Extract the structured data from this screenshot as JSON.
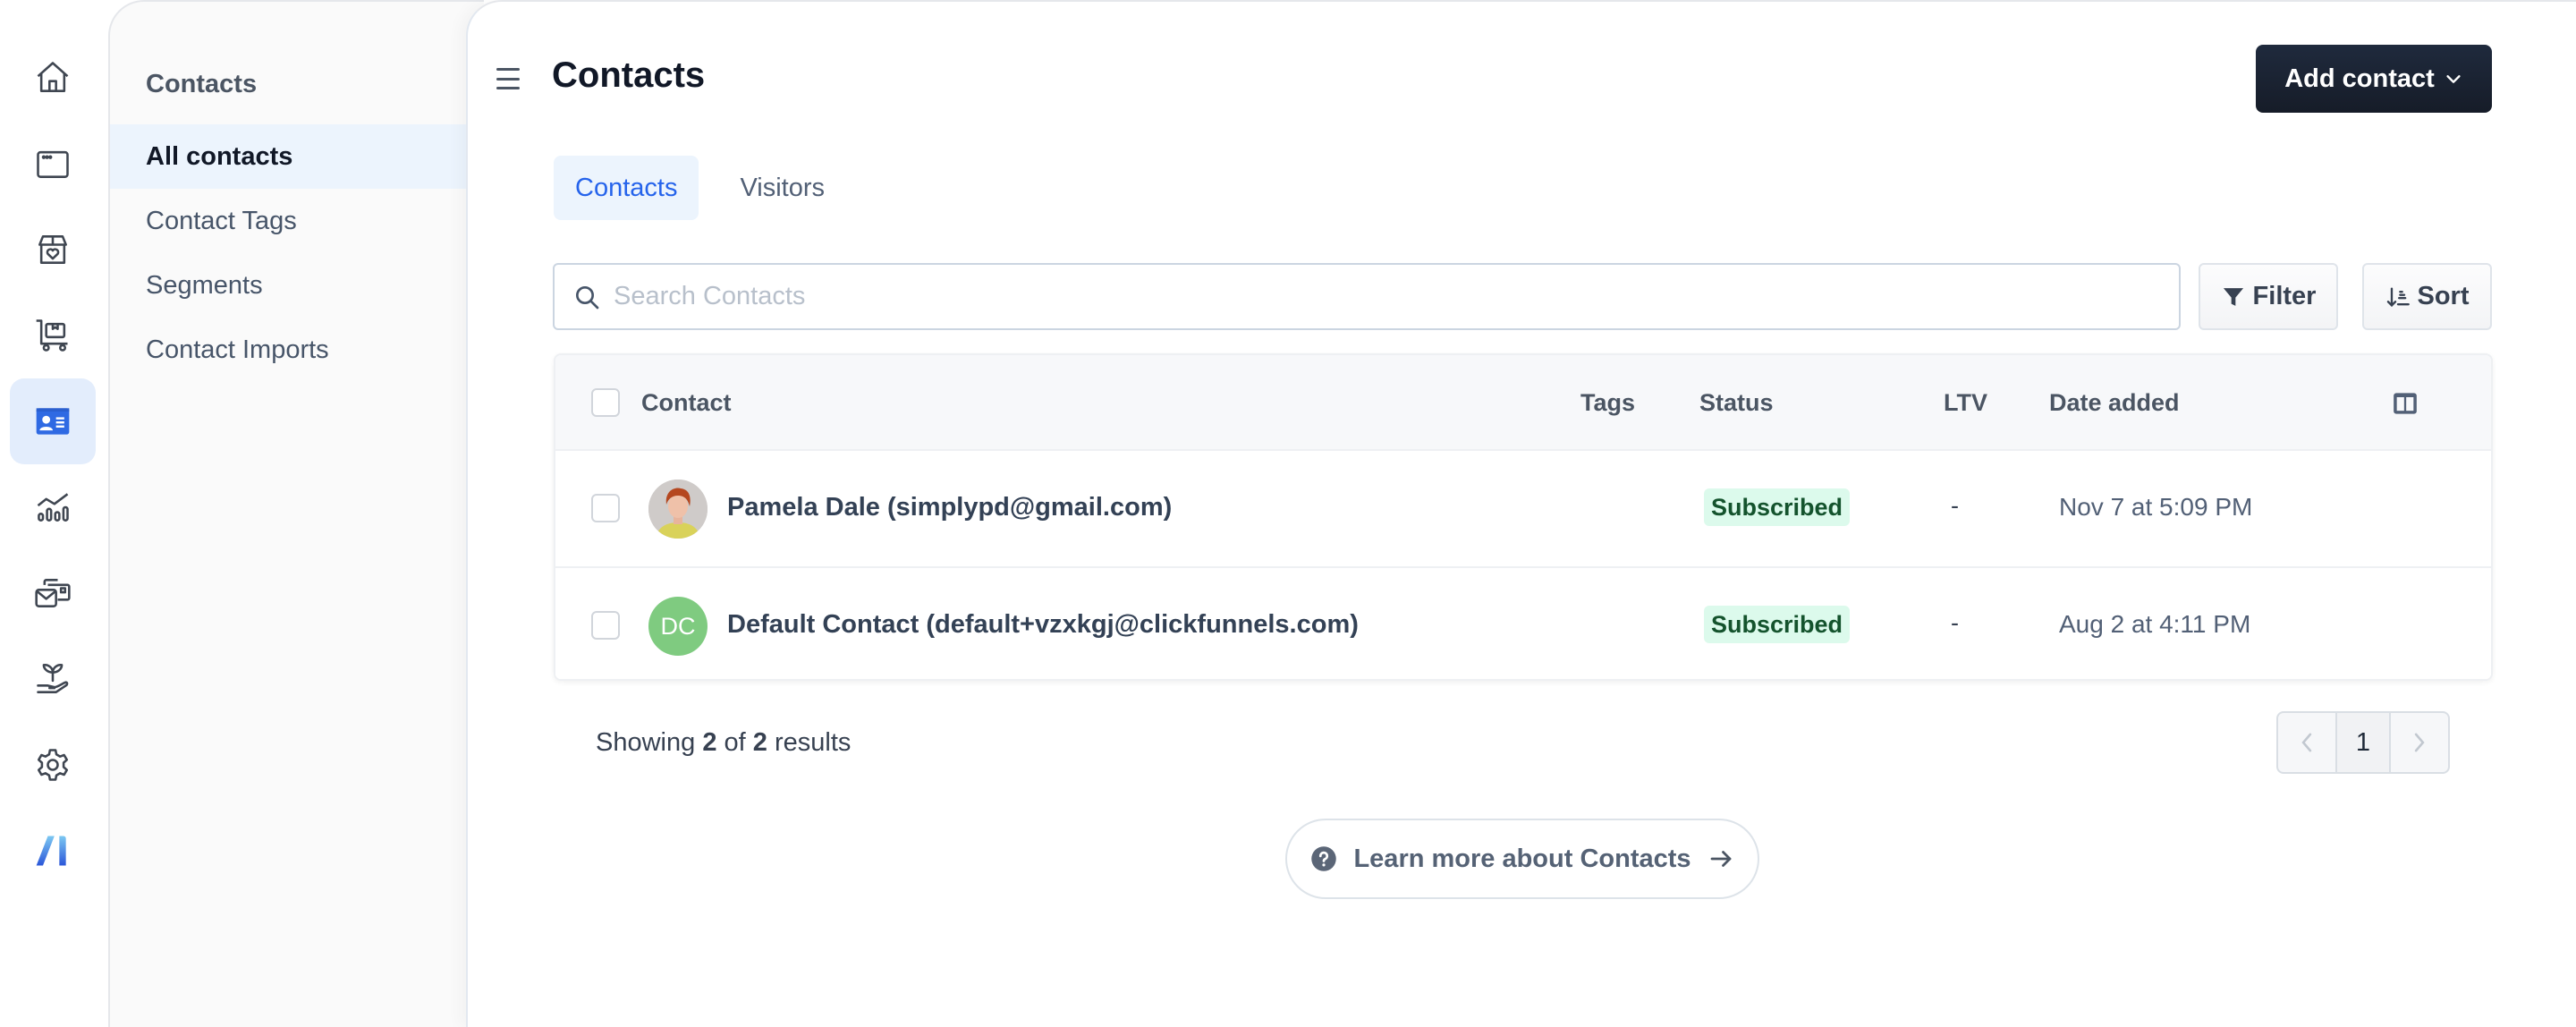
{
  "rail": {
    "items": [
      {
        "name": "home",
        "icon": "home-icon",
        "active": false
      },
      {
        "name": "sites",
        "icon": "browser-window-icon",
        "active": false
      },
      {
        "name": "products",
        "icon": "box-heart-icon",
        "active": false
      },
      {
        "name": "orders",
        "icon": "cart-box-icon",
        "active": false
      },
      {
        "name": "contacts",
        "icon": "contact-card-icon",
        "active": true
      },
      {
        "name": "analytics",
        "icon": "chart-icon",
        "active": false
      },
      {
        "name": "marketing",
        "icon": "mail-wallet-icon",
        "active": false
      },
      {
        "name": "grow",
        "icon": "plant-hand-icon",
        "active": false
      },
      {
        "name": "settings",
        "icon": "gear-icon",
        "active": false
      },
      {
        "name": "ai",
        "icon": "ai-logo-icon",
        "active": false
      }
    ]
  },
  "subnav": {
    "title": "Contacts",
    "items": [
      {
        "label": "All contacts",
        "active": true
      },
      {
        "label": "Contact Tags",
        "active": false
      },
      {
        "label": "Segments",
        "active": false
      },
      {
        "label": "Contact Imports",
        "active": false
      }
    ]
  },
  "header": {
    "title": "Contacts",
    "add_button_label": "Add contact"
  },
  "tabs": [
    {
      "label": "Contacts",
      "active": true
    },
    {
      "label": "Visitors",
      "active": false
    }
  ],
  "search": {
    "placeholder": "Search Contacts",
    "value": ""
  },
  "toolbar": {
    "filter_label": "Filter",
    "sort_label": "Sort"
  },
  "table": {
    "columns": [
      "Contact",
      "Tags",
      "Status",
      "LTV",
      "Date added"
    ],
    "rows": [
      {
        "name": "Pamela Dale (simplypd@gmail.com)",
        "avatar_type": "photo",
        "initials": "",
        "tags": "",
        "status": "Subscribed",
        "ltv": "-",
        "date_added": "Nov 7 at 5:09 PM"
      },
      {
        "name": "Default Contact (default+vzxkgj@clickfunnels.com)",
        "avatar_type": "initials",
        "initials": "DC",
        "avatar_color": "#7fcb80",
        "tags": "",
        "status": "Subscribed",
        "ltv": "-",
        "date_added": "Aug 2 at 4:11 PM"
      }
    ]
  },
  "footer": {
    "showing_prefix": "Showing",
    "shown_count": "2",
    "of_label": "of",
    "total_count": "2",
    "results_label": "results",
    "current_page": "1"
  },
  "learn_more": {
    "label": "Learn more about Contacts"
  },
  "colors": {
    "accent": "#2563eb",
    "primary_button": "#1a2232",
    "active_bg": "#ecf4fd",
    "subscribed_bg": "#dcfaec",
    "subscribed_text": "#14532d"
  }
}
